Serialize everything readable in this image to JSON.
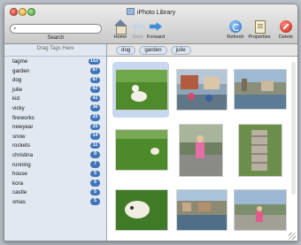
{
  "window": {
    "title": "iPhoto Library"
  },
  "search": {
    "placeholder": "",
    "label": "Search"
  },
  "toolbar": {
    "home_label": "Home",
    "back_label": "Back",
    "forward_label": "Forward",
    "refresh_label": "Refresh",
    "properties_label": "Properties",
    "delete_label": "Delete"
  },
  "sidebar": {
    "drag_hint": "Drag Tags Here",
    "tags": [
      {
        "name": "tagme",
        "count": "153"
      },
      {
        "name": "garden",
        "count": "87"
      },
      {
        "name": "dog",
        "count": "87"
      },
      {
        "name": "julie",
        "count": "82"
      },
      {
        "name": "kid",
        "count": "41"
      },
      {
        "name": "vicky",
        "count": "36"
      },
      {
        "name": "fireworks",
        "count": "25"
      },
      {
        "name": "newyear",
        "count": "25"
      },
      {
        "name": "snow",
        "count": "14"
      },
      {
        "name": "rockets",
        "count": "11"
      },
      {
        "name": "christina",
        "count": "9"
      },
      {
        "name": "running",
        "count": "7"
      },
      {
        "name": "house",
        "count": "5"
      },
      {
        "name": "kora",
        "count": "5"
      },
      {
        "name": "castle",
        "count": "5"
      },
      {
        "name": "xmas",
        "count": "5"
      }
    ]
  },
  "breadcrumb": [
    "dog",
    "garden",
    "julie"
  ]
}
